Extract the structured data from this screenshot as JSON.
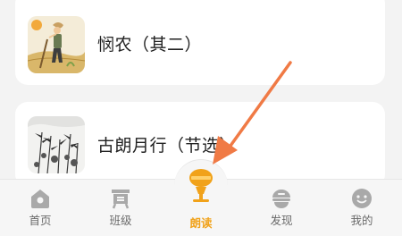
{
  "list": {
    "items": [
      {
        "title": "悯农（其二）",
        "thumb_icon": "farmer-illustration"
      },
      {
        "title": "古朗月行（节选）",
        "thumb_icon": "ink-bamboo-painting"
      }
    ]
  },
  "tabbar": {
    "tabs": [
      {
        "label": "首页",
        "icon": "home-icon"
      },
      {
        "label": "班级",
        "icon": "class-icon"
      },
      {
        "label": "朗读",
        "icon": "microphone-icon",
        "active": true
      },
      {
        "label": "发现",
        "icon": "discover-icon"
      },
      {
        "label": "我的",
        "icon": "profile-icon"
      }
    ]
  },
  "colors": {
    "accent": "#f1a21a",
    "arrow": "#f07a45",
    "inactive": "#a9a9a9"
  }
}
